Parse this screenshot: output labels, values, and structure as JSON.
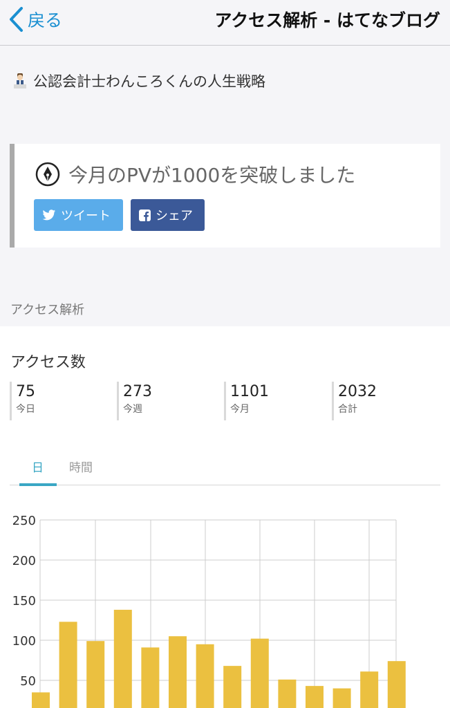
{
  "nav": {
    "back_label": "戻る",
    "title": "アクセス解析 - はてなブログ"
  },
  "blog": {
    "title": "公認会計士わんころくんの人生戦略"
  },
  "milestone": {
    "text": "今月のPVが1000を突破しました",
    "tweet_label": "ツイート",
    "share_label": "シェア",
    "colors": {
      "tweet": "#5aacea",
      "facebook": "#3b5998"
    }
  },
  "section": {
    "label": "アクセス解析"
  },
  "stats": {
    "heading": "アクセス数",
    "items": [
      {
        "value": "75",
        "label": "今日"
      },
      {
        "value": "273",
        "label": "今週"
      },
      {
        "value": "1101",
        "label": "今月"
      },
      {
        "value": "2032",
        "label": "合計"
      }
    ]
  },
  "tabs": {
    "day": "日",
    "hour": "時間",
    "active": "day"
  },
  "chart_data": {
    "type": "bar",
    "bar_color": "#ebc040",
    "y_ticks": [
      50,
      100,
      150,
      200,
      250
    ],
    "ylim": [
      0,
      250
    ],
    "values": [
      35,
      123,
      99,
      138,
      91,
      105,
      95,
      68,
      102,
      51,
      43,
      40,
      61,
      74
    ],
    "grid": true
  }
}
